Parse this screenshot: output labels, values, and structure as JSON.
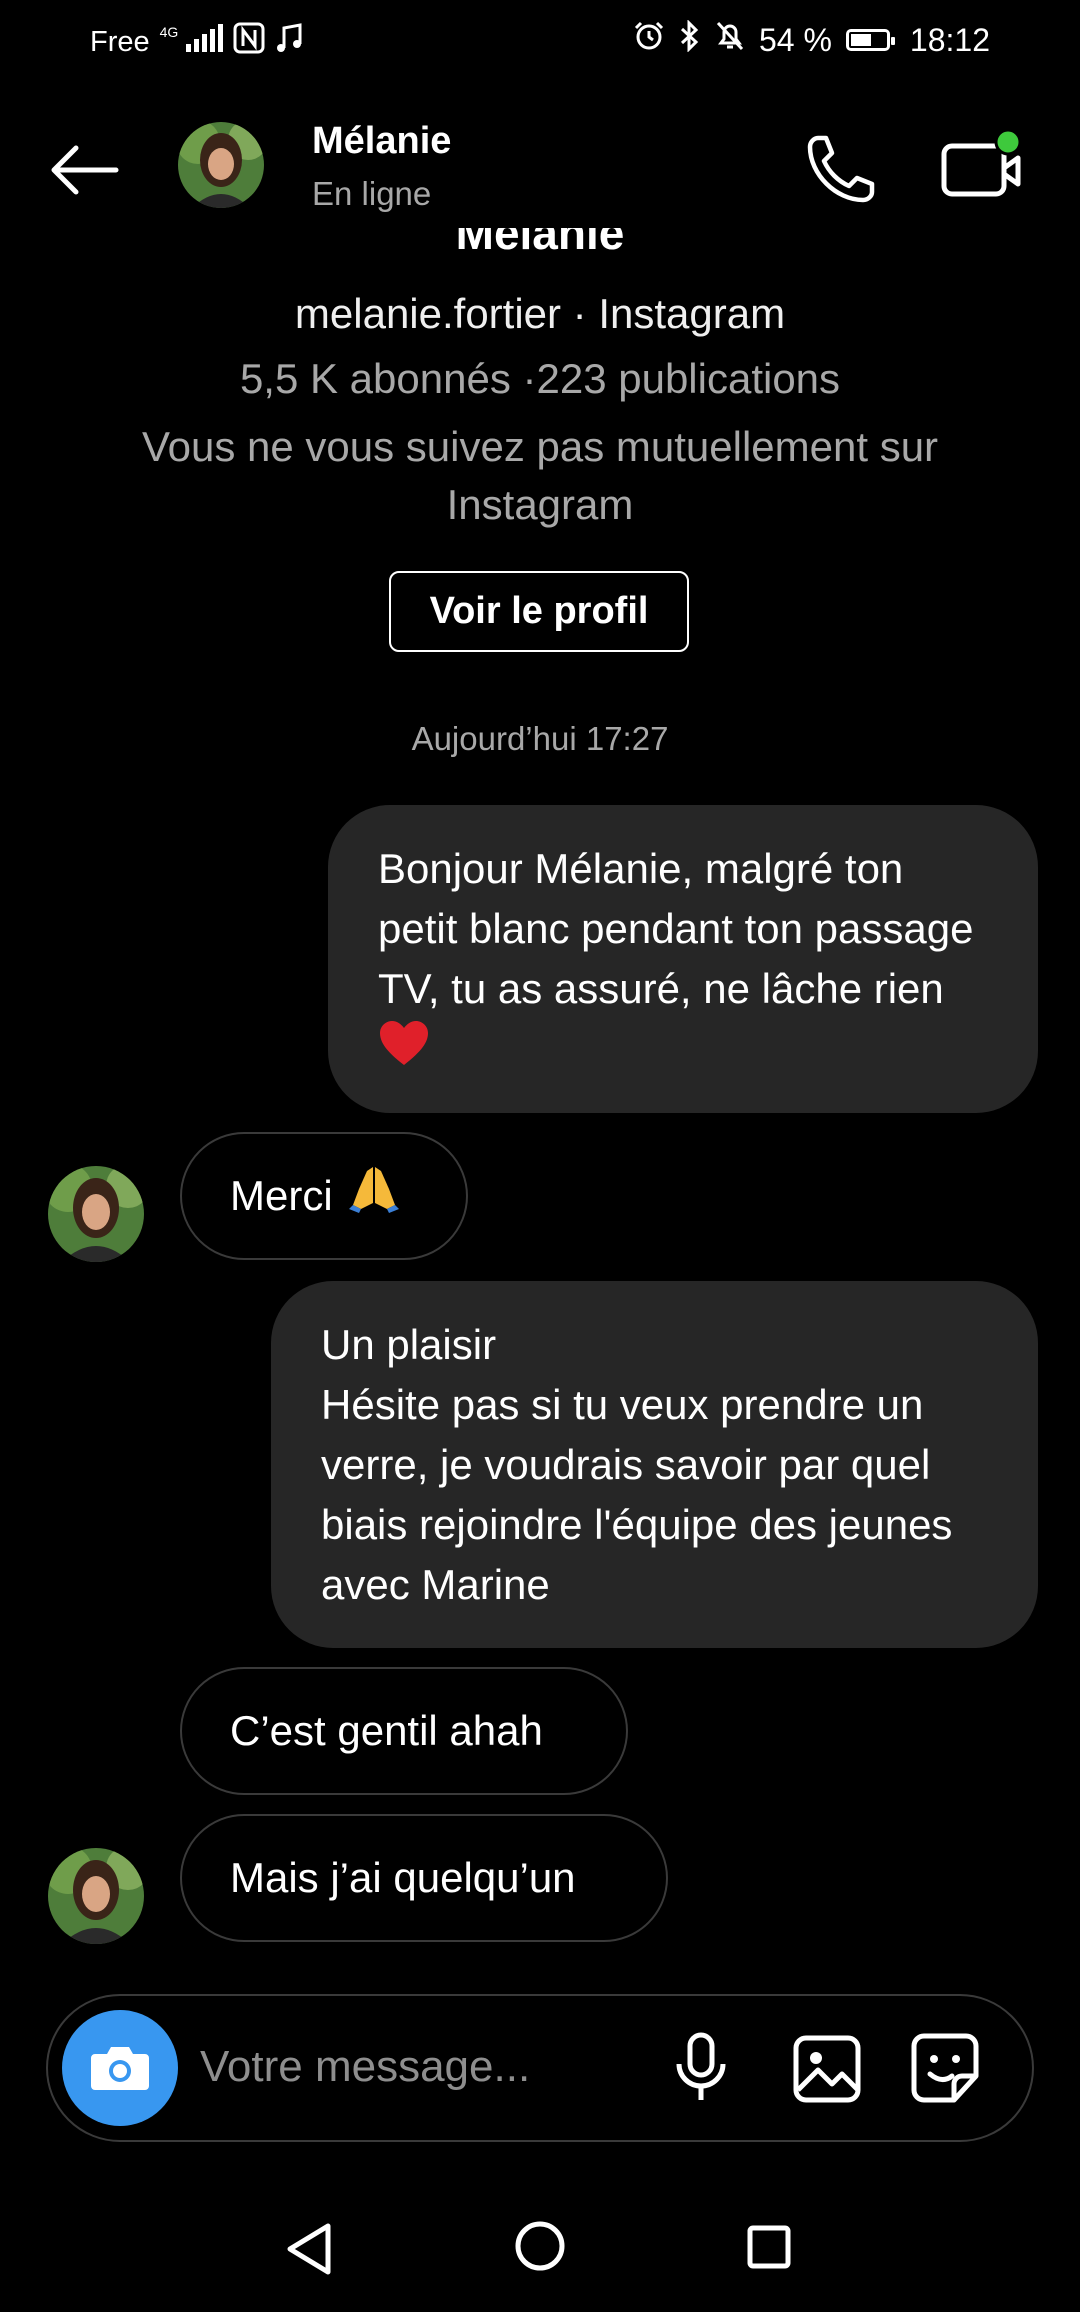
{
  "status_bar": {
    "carrier": "Free",
    "network": "4G",
    "battery": "54 %",
    "time": "18:12"
  },
  "header": {
    "name": "Mélanie",
    "status": "En ligne",
    "back_icon": "arrow-left-icon",
    "call_icon": "phone-icon",
    "video_icon": "video-camera-icon"
  },
  "profile": {
    "name": "Mélanie",
    "handle": "melanie.fortier · Instagram",
    "stats": "5,5 K abonnés ·223 publications",
    "mutual": "Vous ne vous suivez pas mutuellement sur Instagram",
    "view_profile_label": "Voir le profil"
  },
  "conversation": {
    "timestamp": "Aujourd’hui 17:27",
    "messages": [
      {
        "from": "me",
        "text": "Bonjour Mélanie, malgré ton petit blanc pendant ton passage TV, tu as assuré, ne lâche rien",
        "emoji": "red-heart"
      },
      {
        "from": "them",
        "text": "Merci",
        "emoji": "folded-hands"
      },
      {
        "from": "me",
        "lines": [
          "Un plaisir",
          "Hésite pas si tu veux prendre un verre, je voudrais savoir par quel biais rejoindre l'équipe des jeunes avec Marine"
        ]
      },
      {
        "from": "them",
        "text": "C’est gentil ahah"
      },
      {
        "from": "them",
        "text": "Mais j’ai quelqu’un"
      }
    ]
  },
  "composer": {
    "placeholder": "Votre message...",
    "camera_icon": "camera-icon",
    "mic_icon": "microphone-icon",
    "gallery_icon": "image-icon",
    "sticker_icon": "sticker-icon"
  },
  "colors": {
    "background": "#000000",
    "bubble_out": "#262626",
    "camera_button": "#3897f0",
    "online_dot": "#3ec93c",
    "secondary_text": "#a8a8a8"
  }
}
